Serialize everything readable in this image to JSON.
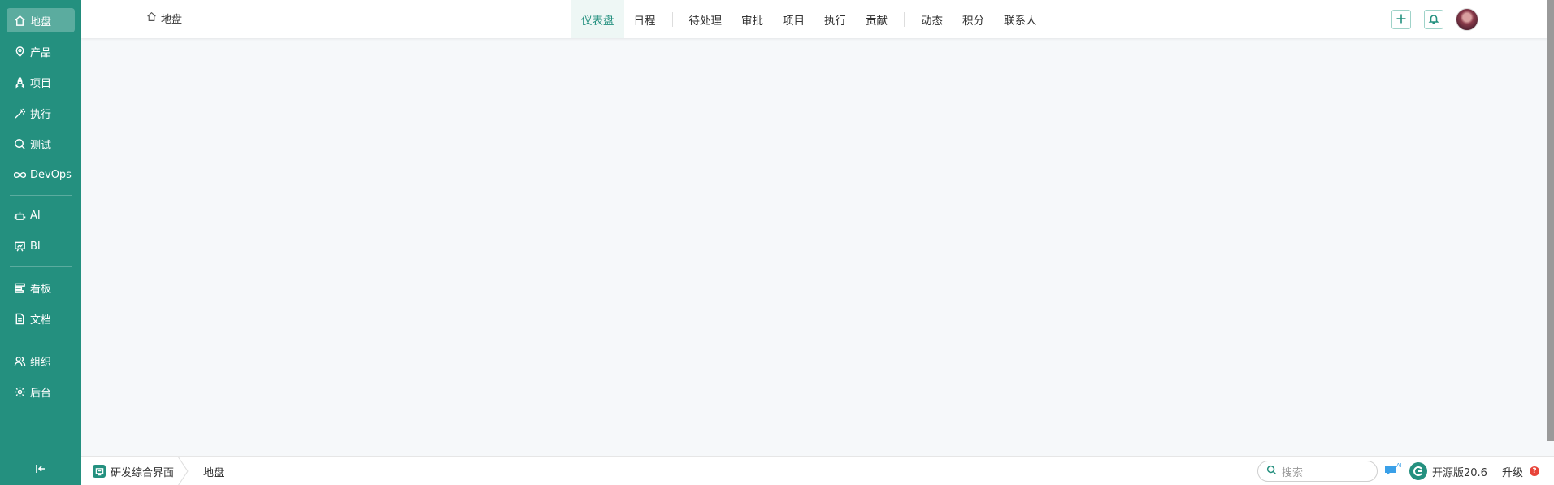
{
  "sidebar": {
    "items": [
      {
        "label": "地盘",
        "icon": "home-icon",
        "active": true
      },
      {
        "label": "产品",
        "icon": "location-pin-icon"
      },
      {
        "label": "项目",
        "icon": "rocket-icon"
      },
      {
        "label": "执行",
        "icon": "wand-icon"
      },
      {
        "label": "测试",
        "icon": "magnifier-icon"
      },
      {
        "label": "DevOps",
        "icon": "infinity-icon"
      },
      {
        "label": "AI",
        "icon": "robot-icon"
      },
      {
        "label": "BI",
        "icon": "presentation-chart-icon"
      },
      {
        "label": "看板",
        "icon": "kanban-icon"
      },
      {
        "label": "文档",
        "icon": "document-icon"
      },
      {
        "label": "组织",
        "icon": "people-icon"
      },
      {
        "label": "后台",
        "icon": "gear-icon"
      }
    ],
    "accent_color": "#24907f"
  },
  "header": {
    "breadcrumb": "地盘",
    "tabs": [
      {
        "label": "仪表盘",
        "active": true
      },
      {
        "label": "日程"
      },
      {
        "label": "待处理"
      },
      {
        "label": "审批"
      },
      {
        "label": "项目"
      },
      {
        "label": "执行"
      },
      {
        "label": "贡献"
      },
      {
        "label": "动态"
      },
      {
        "label": "积分"
      },
      {
        "label": "联系人"
      }
    ]
  },
  "footer": {
    "app_name": "研发综合界面",
    "current_page": "地盘",
    "search_placeholder": "搜索",
    "edition": "开源版20.6",
    "upgrade": "升级",
    "upgrade_badge": "?"
  }
}
